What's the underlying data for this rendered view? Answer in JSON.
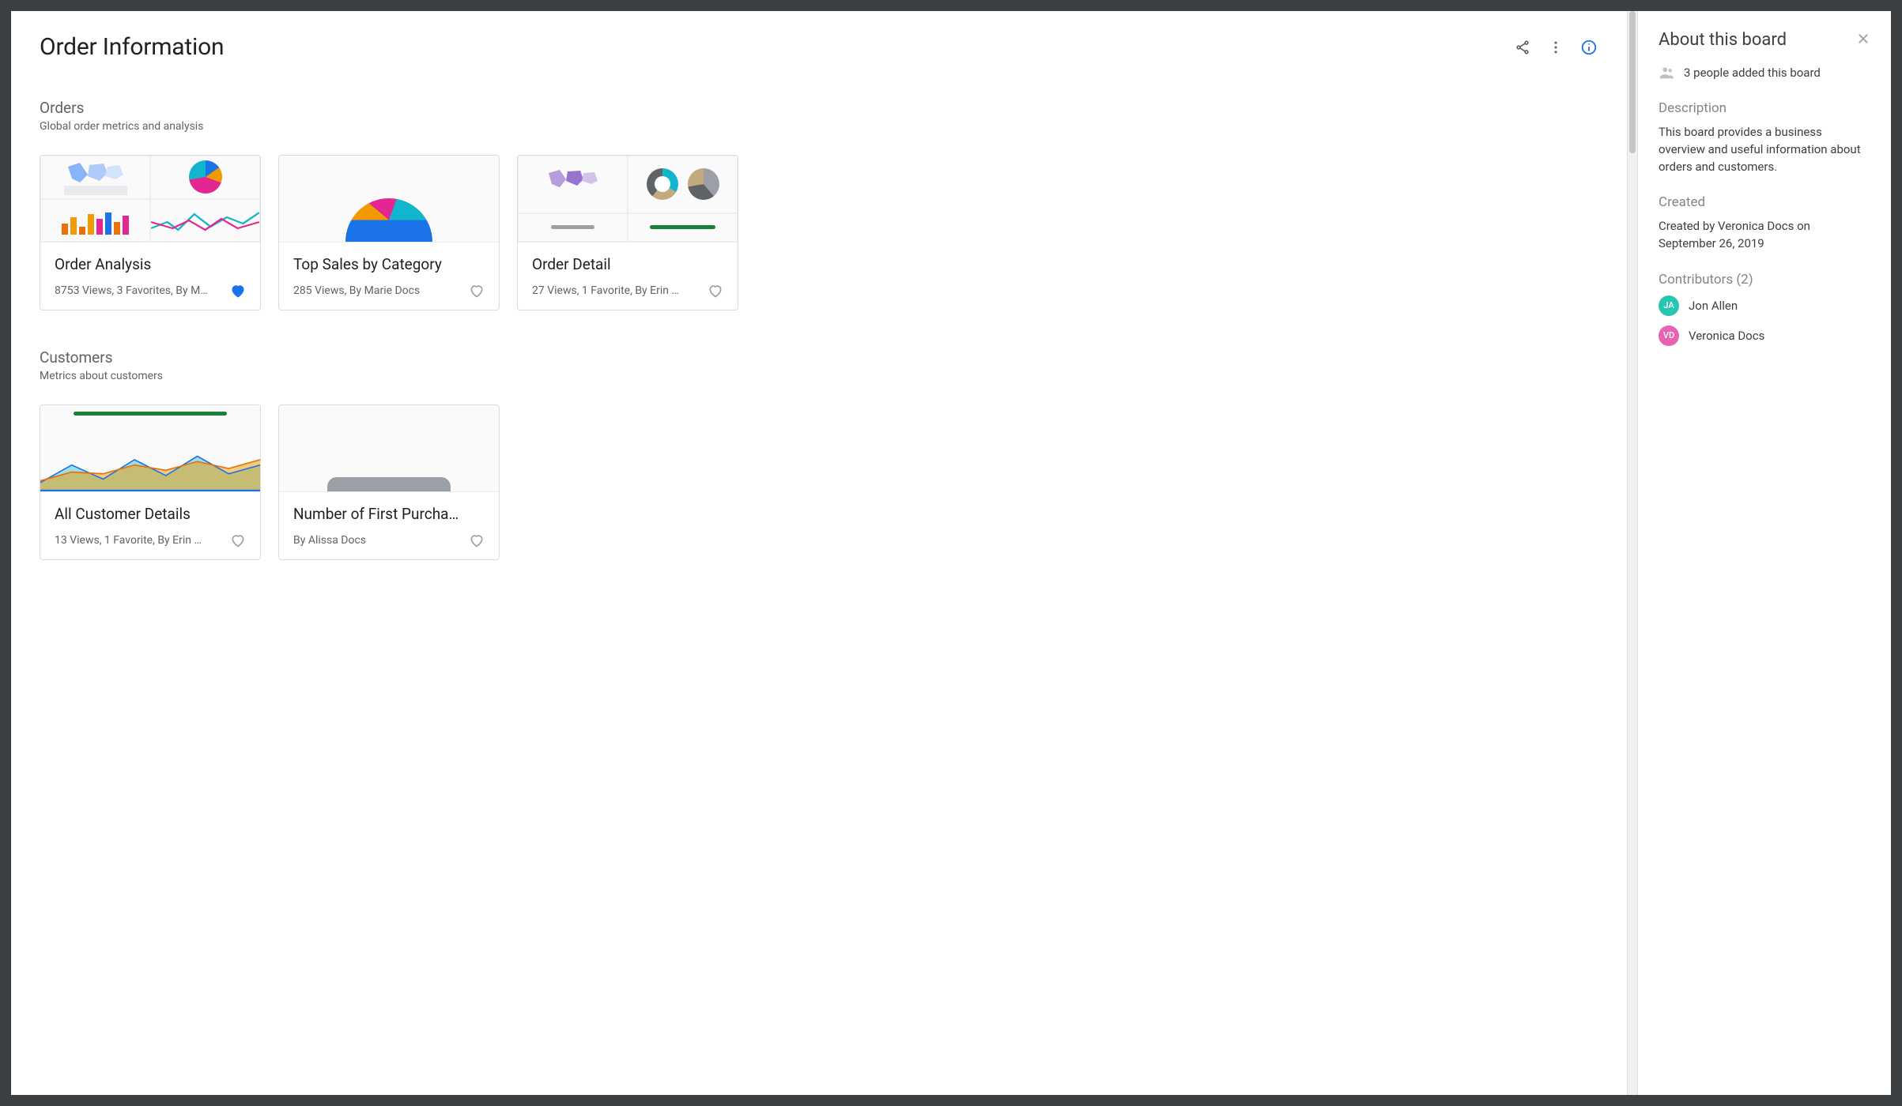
{
  "header": {
    "title": "Order Information"
  },
  "sections": [
    {
      "title": "Orders",
      "desc": "Global order metrics and analysis",
      "cards": [
        {
          "title": "Order Analysis",
          "meta": "8753 Views, 3 Favorites, By M…",
          "fav": true
        },
        {
          "title": "Top Sales by Category",
          "meta": "285 Views, By Marie Docs",
          "fav": false
        },
        {
          "title": "Order Detail",
          "meta": "27 Views, 1 Favorite, By Erin …",
          "fav": false
        }
      ]
    },
    {
      "title": "Customers",
      "desc": "Metrics about customers",
      "cards": [
        {
          "title": "All Customer Details",
          "meta": "13 Views, 1 Favorite, By Erin …",
          "fav": false
        },
        {
          "title": "Number of First Purcha…",
          "meta": "By Alissa Docs",
          "fav": false
        }
      ]
    }
  ],
  "panel": {
    "title": "About this board",
    "people_line": "3 people added this board",
    "description_label": "Description",
    "description_text": "This board provides a business overview and useful information about orders and customers.",
    "created_label": "Created",
    "created_text": "Created by Veronica Docs on September 26, 2019",
    "contributors_label": "Contributors (2)",
    "contributors": [
      {
        "initials": "JA",
        "name": "Jon Allen",
        "color": "#26c6b2"
      },
      {
        "initials": "VD",
        "name": "Veronica Docs",
        "color": "#e762b0"
      }
    ]
  }
}
